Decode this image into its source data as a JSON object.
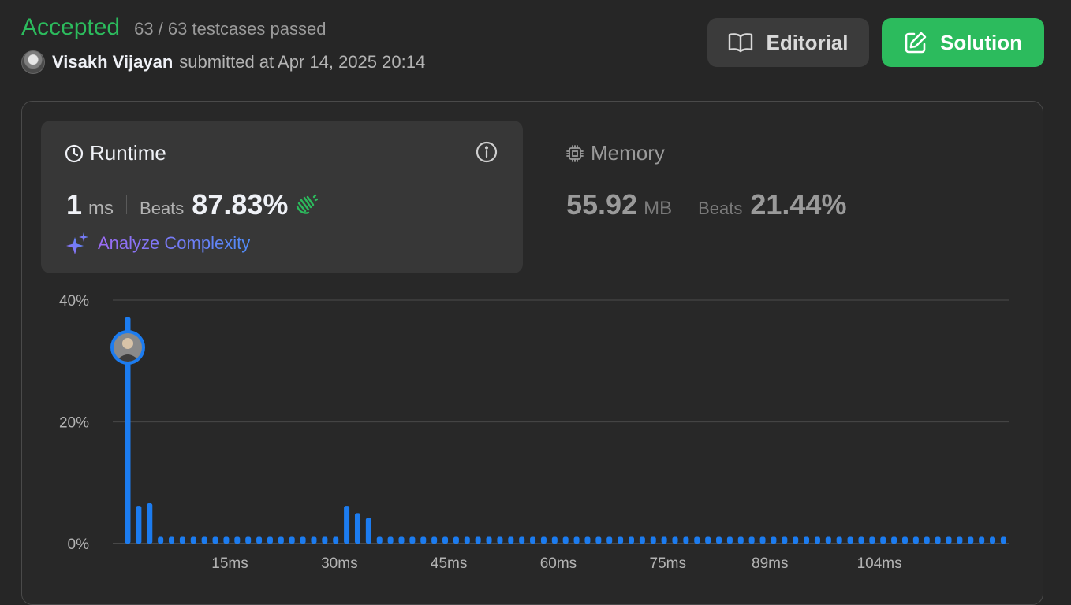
{
  "header": {
    "status": "Accepted",
    "testcases": "63 / 63 testcases passed",
    "username": "Visakh Vijayan",
    "submitted": "submitted at Apr 14, 2025 20:14"
  },
  "buttons": {
    "editorial": "Editorial",
    "solution": "Solution"
  },
  "runtime": {
    "title": "Runtime",
    "value": "1",
    "unit": "ms",
    "beats_label": "Beats",
    "beats_value": "87.83%",
    "analyze": "Analyze Complexity"
  },
  "memory": {
    "title": "Memory",
    "value": "55.92",
    "unit": "MB",
    "beats_label": "Beats",
    "beats_value": "21.44%"
  },
  "colors": {
    "accepted": "#2cbb5d",
    "bar": "#1c7cf0",
    "solution_button": "#2cbb5d"
  },
  "icons": {
    "editorial": "book-icon",
    "solution": "edit-icon",
    "runtime": "clock-icon",
    "memory": "chip-icon",
    "info": "info-icon",
    "analyze": "sparkle-icon",
    "beats": "clap-icon"
  },
  "chart_data": {
    "type": "bar",
    "ylim": [
      0,
      40
    ],
    "y_ticks": [
      0,
      20,
      40
    ],
    "y_tick_labels": [
      "0%",
      "20%",
      "40%"
    ],
    "x_ticks": [
      15,
      30,
      45,
      60,
      75,
      89,
      104
    ],
    "x_tick_labels": [
      "15ms",
      "30ms",
      "45ms",
      "60ms",
      "75ms",
      "89ms",
      "104ms"
    ],
    "x_start": 1,
    "x_step": 1.5,
    "highlight_index": 0,
    "values": [
      37.2,
      6.2,
      6.6,
      1.1,
      1.1,
      1.1,
      1.1,
      1.1,
      1.1,
      1.1,
      1.1,
      1.1,
      1.1,
      1.1,
      1.1,
      1.1,
      1.1,
      1.1,
      1.1,
      1.1,
      6.2,
      5.0,
      4.2,
      1.1,
      1.1,
      1.1,
      1.1,
      1.1,
      1.1,
      1.1,
      1.1,
      1.1,
      1.1,
      1.1,
      1.1,
      1.1,
      1.1,
      1.1,
      1.1,
      1.1,
      1.1,
      1.1,
      1.1,
      1.1,
      1.1,
      1.1,
      1.1,
      1.1,
      1.1,
      1.1,
      1.1,
      1.1,
      1.1,
      1.1,
      1.1,
      1.1,
      1.1,
      1.1,
      1.1,
      1.1,
      1.1,
      1.1,
      1.1,
      1.1,
      1.1,
      1.1,
      1.1,
      1.1,
      1.1,
      1.1,
      1.1,
      1.1,
      1.1,
      1.1,
      1.1,
      1.1,
      1.1,
      1.1,
      1.1,
      1.1,
      1.1
    ]
  }
}
